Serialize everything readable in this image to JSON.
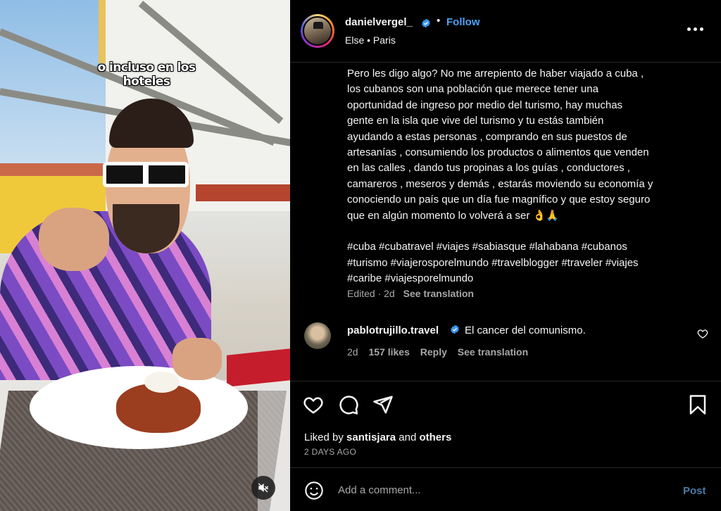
{
  "media": {
    "overlay_caption": "o incluso en los hoteles",
    "mute_icon": "speaker-muted-icon"
  },
  "header": {
    "username": "danielvergel_",
    "verified_icon": "verified-badge-icon",
    "separator": "•",
    "follow_label": "Follow",
    "sub_prefix": "Else",
    "sub_sep": "•",
    "sub_location": "Paris",
    "more_icon": "more-options-icon"
  },
  "caption": {
    "lines": [
      "Pero les digo algo? No me arrepiento de haber viajado a cuba ,",
      "los cubanos son una población que merece tener una",
      "oportunidad de ingreso por medio del turismo, hay muchas",
      "gente en la isla que vive del turismo y tu estás también",
      "ayudando a estas personas , comprando en sus puestos de",
      "artesanías , consumiendo los productos o alimentos que venden",
      "en las calles , dando tus propinas a los guías , conductores ,",
      "camareros , meseros y demás , estarás moviendo su economía y",
      "conociendo un país que un día fue magnífico y que estoy seguro",
      "que en algún momento lo volverá a ser 👌🙏"
    ],
    "hashtag_lines": [
      "#cuba #cubatravel #viajes #sabiasque #lahabana #cubanos",
      "#turismo #viajerosporelmundo #travelblogger #traveler #viajes",
      "#caribe #viajesporelmundo"
    ],
    "edited": "Edited · 2d",
    "see_translation": "See translation"
  },
  "comment": {
    "username": "pablotrujillo.travel",
    "text": "El cancer del comunismo.",
    "age": "2d",
    "likes": "157 likes",
    "reply": "Reply",
    "see_translation": "See translation",
    "heart_icon": "heart-outline-icon"
  },
  "actions": {
    "like_icon": "heart-icon",
    "comment_icon": "comment-icon",
    "share_icon": "share-icon",
    "save_icon": "bookmark-icon",
    "liked_by_prefix": "Liked by",
    "liked_by_user": "santisjara",
    "liked_by_and": "and",
    "liked_by_others": "others",
    "timestamp": "2 DAYS AGO"
  },
  "add_comment": {
    "emoji_icon": "emoji-icon",
    "placeholder": "Add a comment...",
    "post_label": "Post"
  },
  "colors": {
    "accent": "#4ea3f7",
    "post_disabled": "#4a7ba8",
    "muted_text": "#a8a8a8",
    "background": "#000000"
  }
}
